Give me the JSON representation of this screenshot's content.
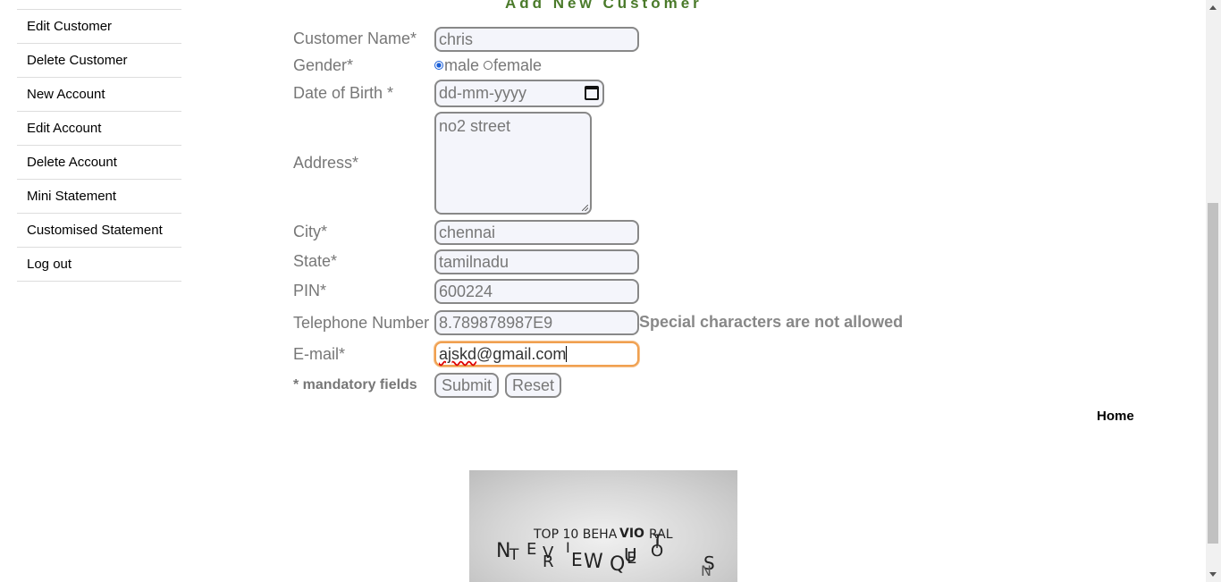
{
  "sidebar": {
    "items": [
      {
        "label": "Edit Customer"
      },
      {
        "label": "Delete Customer"
      },
      {
        "label": "New Account"
      },
      {
        "label": "Edit Account"
      },
      {
        "label": "Delete Account"
      },
      {
        "label": "Mini Statement"
      },
      {
        "label": "Customised Statement"
      },
      {
        "label": "Log out"
      }
    ]
  },
  "form": {
    "title": "Add New Customer",
    "customer_name": {
      "label": "Customer Name*",
      "value": "chris"
    },
    "gender": {
      "label": "Gender*",
      "options": [
        "male",
        "female"
      ],
      "selected": "male"
    },
    "dob": {
      "label": "Date of Birth *",
      "placeholder": "dd-mm-yyyy"
    },
    "address": {
      "label": "Address*",
      "value": "no2 street"
    },
    "city": {
      "label": "City*",
      "value": "chennai"
    },
    "state": {
      "label": "State*",
      "value": "tamilnadu"
    },
    "pin": {
      "label": "PIN*",
      "value": "600224"
    },
    "telephone": {
      "label": "Telephone Number",
      "value": "8.789878987E9",
      "error": "Special characters are not allowed"
    },
    "email": {
      "label": "E-mail*",
      "value_misspelled": "ajskd",
      "value_rest": "@gmail.com"
    },
    "mandatory_note": "* mandatory fields",
    "submit_label": "Submit",
    "reset_label": "Reset"
  },
  "home_link": "Home",
  "banner": {
    "line1": "TOP 10 BEHA",
    "line1b": "VIO",
    "line1c": "RAL",
    "letters": [
      "N",
      "T",
      "E",
      "R",
      "V",
      "I",
      "E",
      "W",
      "Q",
      "U",
      "E",
      "S",
      "T",
      "I",
      "O",
      "N",
      "S"
    ]
  }
}
